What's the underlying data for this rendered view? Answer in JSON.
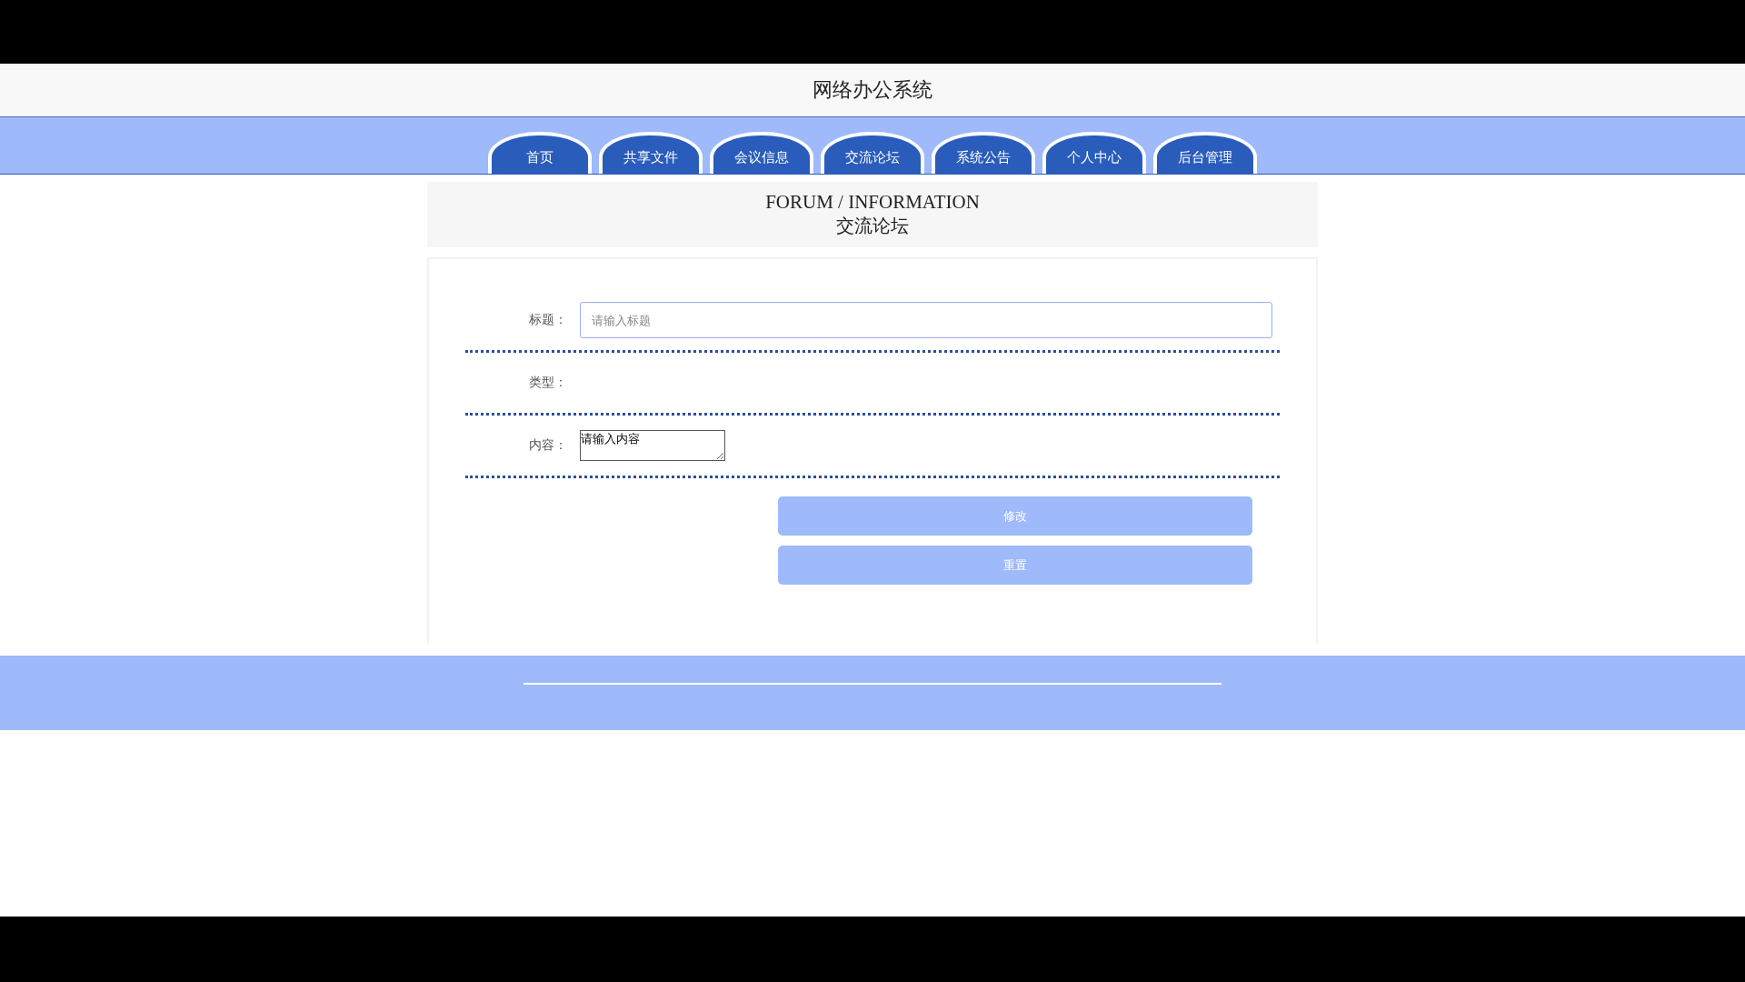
{
  "header": {
    "title": "网络办公系统"
  },
  "nav": [
    {
      "label": "首页",
      "selected": false
    },
    {
      "label": "共享文件",
      "selected": false
    },
    {
      "label": "会议信息",
      "selected": false
    },
    {
      "label": "交流论坛",
      "selected": false
    },
    {
      "label": "系统公告",
      "selected": false
    },
    {
      "label": "个人中心",
      "selected": false
    },
    {
      "label": "后台管理",
      "selected": false
    }
  ],
  "section": {
    "title_en": "FORUM / INFORMATION",
    "title_zh": "交流论坛"
  },
  "form": {
    "fields": [
      {
        "kind": "input",
        "label": "标题：",
        "placeholder": "请输入标题"
      },
      {
        "kind": "none",
        "label": "类型："
      },
      {
        "kind": "textarea",
        "label": "内容：",
        "value": "请输入内容"
      }
    ],
    "buttons": [
      "修改",
      "重置"
    ]
  }
}
